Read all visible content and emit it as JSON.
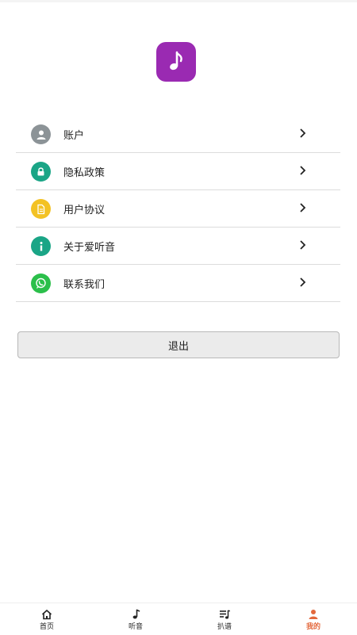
{
  "app": {
    "logo_icon": "music-note-icon",
    "logo_color": "#9a2ab2"
  },
  "menu": {
    "items": [
      {
        "label": "账户",
        "icon": "user-icon",
        "icon_color": "#8c9397"
      },
      {
        "label": "隐私政策",
        "icon": "lock-icon",
        "icon_color": "#1aa586"
      },
      {
        "label": "用户协议",
        "icon": "document-icon",
        "icon_color": "#f3c224"
      },
      {
        "label": "关于爱听音",
        "icon": "info-icon",
        "icon_color": "#1aa586"
      },
      {
        "label": "联系我们",
        "icon": "whatsapp-icon",
        "icon_color": "#2bbf4a"
      }
    ]
  },
  "logout": {
    "label": "退出"
  },
  "tabbar": {
    "active_color": "#e3683c",
    "tabs": [
      {
        "label": "首页",
        "icon": "home-icon",
        "active": false
      },
      {
        "label": "听音",
        "icon": "music-note-icon",
        "active": false
      },
      {
        "label": "扒谱",
        "icon": "playlist-icon",
        "active": false
      },
      {
        "label": "我的",
        "icon": "profile-icon",
        "active": true
      }
    ]
  }
}
